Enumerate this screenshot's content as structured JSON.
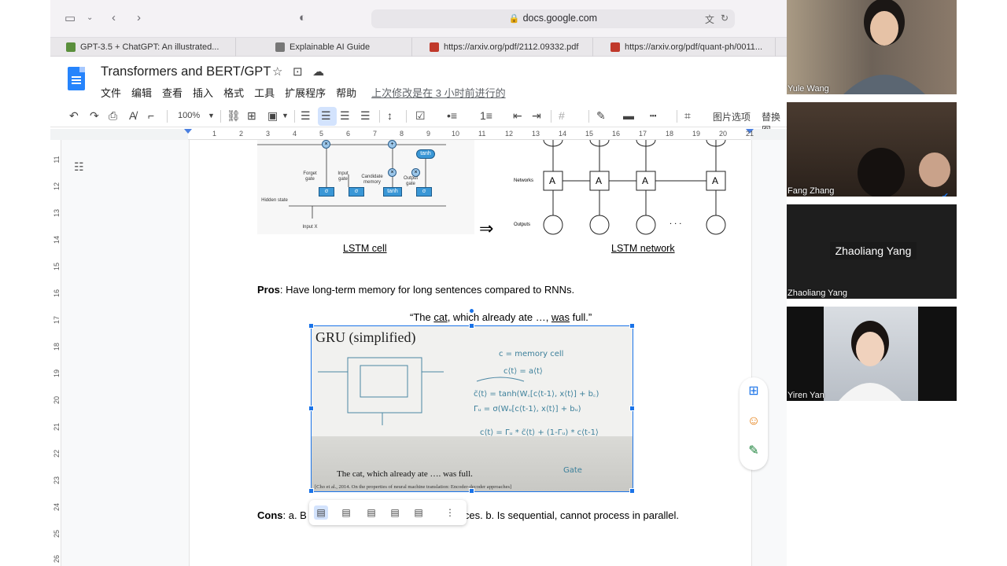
{
  "browser": {
    "url": "docs.google.com",
    "tabs": [
      {
        "label": "GPT-3.5 + ChatGPT: An illustrated...",
        "color": "#5a8f3c"
      },
      {
        "label": "Explainable AI Guide",
        "color": "#777777"
      },
      {
        "label": "https://arxiv.org/pdf/2112.09332.pdf",
        "color": "#c0392b"
      },
      {
        "label": "https://arxiv.org/pdf/quant-ph/0011...",
        "color": "#c0392b"
      }
    ]
  },
  "docs": {
    "title": "Transformers and BERT/GPT",
    "menu": [
      "文件",
      "编辑",
      "查看",
      "插入",
      "格式",
      "工具",
      "扩展程序",
      "帮助"
    ],
    "last_edit": "上次修改是在 3 小时前进行的",
    "zoom": "100%",
    "image_options": "图片选项",
    "replace_image": "替换图"
  },
  "ruler": {
    "h": [
      "1",
      "1",
      "2",
      "3",
      "4",
      "5",
      "6",
      "7",
      "8",
      "9",
      "10",
      "11",
      "12",
      "13",
      "14",
      "15",
      "16",
      "17",
      "18",
      "19",
      "20",
      "21"
    ],
    "v": [
      "11",
      "12",
      "13",
      "14",
      "15",
      "16",
      "17",
      "18",
      "19",
      "20",
      "21",
      "22",
      "23",
      "24",
      "25",
      "26"
    ]
  },
  "content": {
    "lstm_cell_caption": "LSTM cell",
    "lstm_network_caption": "LSTM network",
    "pros_label": "Pros",
    "pros_text": ": Have long-term memory for long sentences compared to RNNs.",
    "quote_open": "“The ",
    "quote_cat": "cat",
    "quote_mid": ", which already ate …, ",
    "quote_was": "was",
    "quote_end": " full.”",
    "cons_label": "Cons",
    "cons_text_a": ": a. B",
    "cons_text_b": "ces. b. Is sequential, cannot process in parallel.",
    "cell_labels": {
      "forget": "Forget gate",
      "input": "Input gate",
      "candidate": "Candidate memory",
      "output": "Output gate",
      "hidden": "Hidden state",
      "input_x": "Input X",
      "tanh": "tanh"
    },
    "net_labels": {
      "networks": "Networks",
      "outputs": "Outputs",
      "node": "A",
      "dots": ". . ."
    },
    "gru": {
      "title": "GRU (simplified)",
      "caption": "The cat, which already ate …. was full.",
      "ref": "[Cho et al., 2014. On the properties of neural machine translation: Encoder-decoder approaches]",
      "gate_note": "Gate"
    }
  },
  "participants": [
    {
      "name": "Yule Wang"
    },
    {
      "name": "Fang Zhang"
    },
    {
      "name": "Zhaoliang Yang",
      "display": "Zhaoliang Yang"
    },
    {
      "name": "Yiren Yan"
    }
  ]
}
